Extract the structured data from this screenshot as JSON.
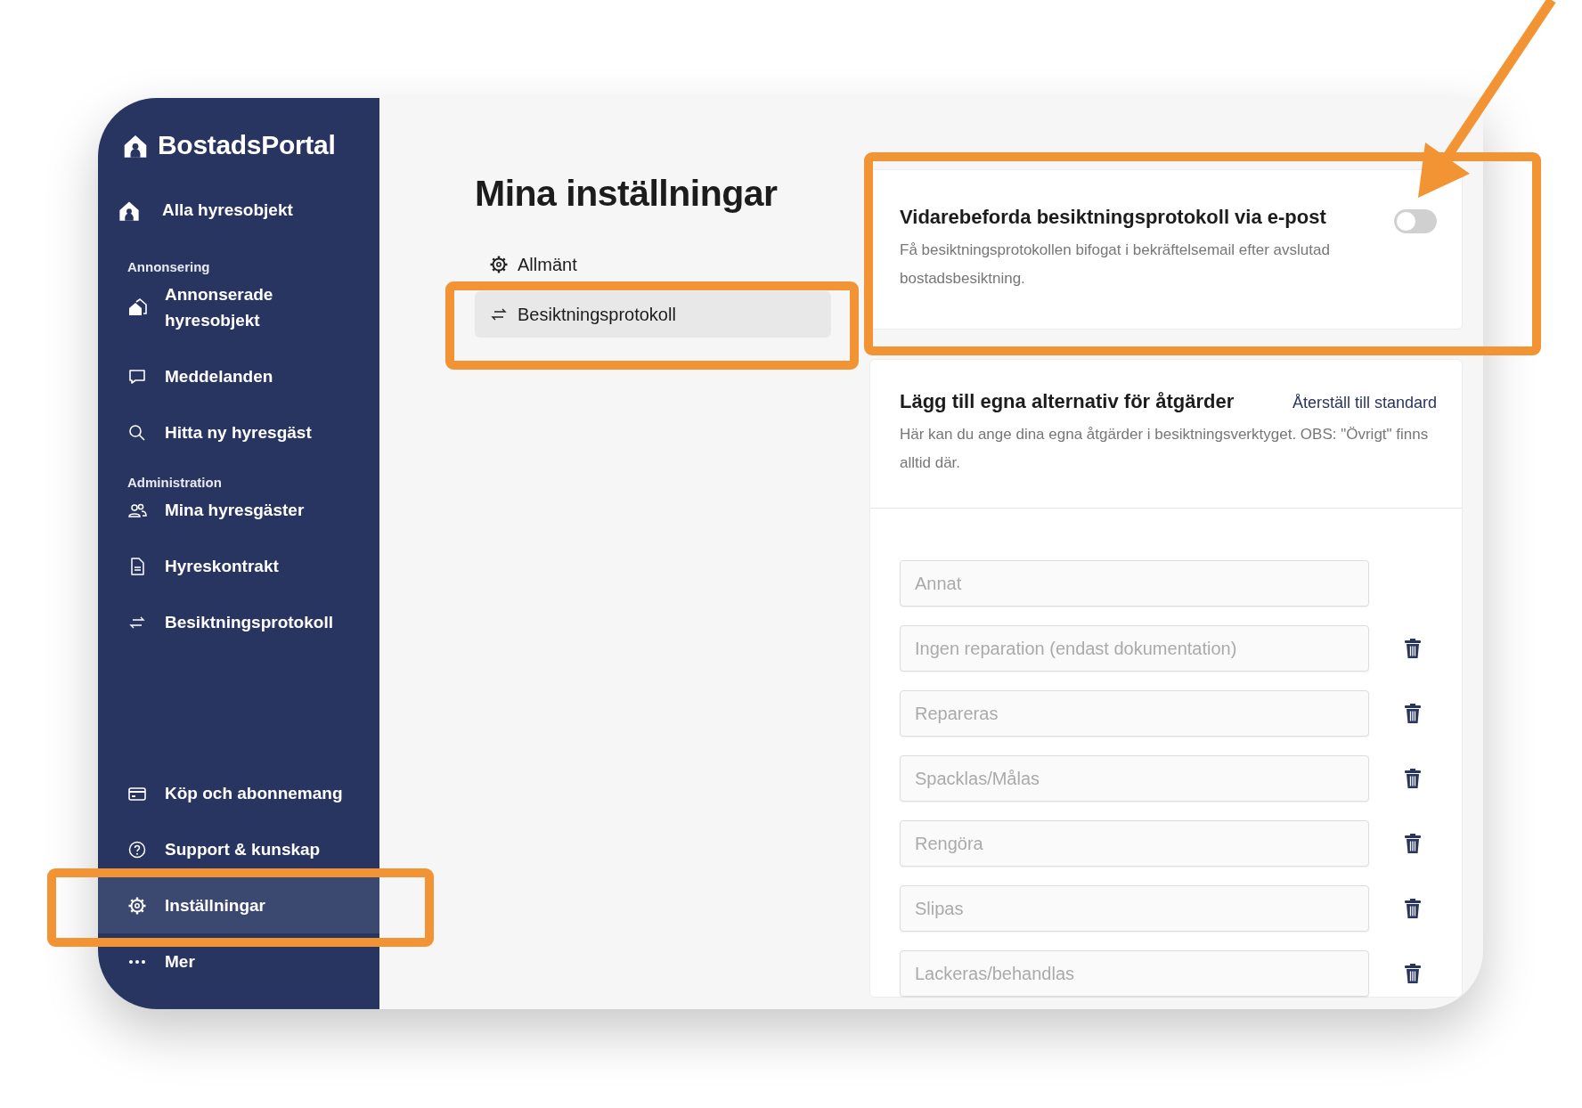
{
  "sidebar": {
    "brand": "BostadsPortal",
    "home": {
      "label": "Alla hyresobjekt",
      "selected": false
    },
    "sections": [
      {
        "heading": "Annonsering",
        "items": [
          {
            "label": "Annonserade hyresobjekt",
            "selected": false
          },
          {
            "label": "Meddelanden",
            "selected": false
          },
          {
            "label": "Hitta ny hyresgäst",
            "selected": false
          }
        ]
      },
      {
        "heading": "Administration",
        "items": [
          {
            "label": "Mina hyresgäster",
            "selected": false
          },
          {
            "label": "Hyreskontrakt",
            "selected": false
          },
          {
            "label": "Besiktningsprotokoll",
            "selected": false
          }
        ]
      }
    ],
    "footer_items": [
      {
        "label": "Köp och abonnemang",
        "selected": false
      },
      {
        "label": "Support & kunskap",
        "selected": false
      },
      {
        "label": "Inställningar",
        "selected": true
      },
      {
        "label": "Mer",
        "selected": false
      }
    ]
  },
  "page_title": "Mina inställningar",
  "settings_nav": [
    {
      "label": "Allmänt",
      "selected": false
    },
    {
      "label": "Besiktningsprotokoll",
      "selected": true
    }
  ],
  "email_card": {
    "title": "Vidarebeforda besiktningsprotokoll via e-post",
    "description": "Få besiktningsprotokollen bifogat i bekräftelsemail efter avslutad bostadsbesiktning.",
    "toggle": {
      "on": false
    }
  },
  "actions_card": {
    "title": "Lägg till egna alternativ för åtgärder",
    "reset_link": "Återställ till standard",
    "description": "Här kan du ange dina egna åtgärder i besiktningsverktyget. OBS: \"Övrigt\" finns alltid där.",
    "options": [
      {
        "placeholder": "Annat",
        "deletable": false
      },
      {
        "placeholder": "Ingen reparation (endast dokumentation)",
        "deletable": true
      },
      {
        "placeholder": "Repareras",
        "deletable": true
      },
      {
        "placeholder": "Spacklas/Målas",
        "deletable": true
      },
      {
        "placeholder": "Rengöra",
        "deletable": true
      },
      {
        "placeholder": "Slipas",
        "deletable": true
      },
      {
        "placeholder": "Lackeras/behandlas",
        "deletable": true
      }
    ]
  }
}
